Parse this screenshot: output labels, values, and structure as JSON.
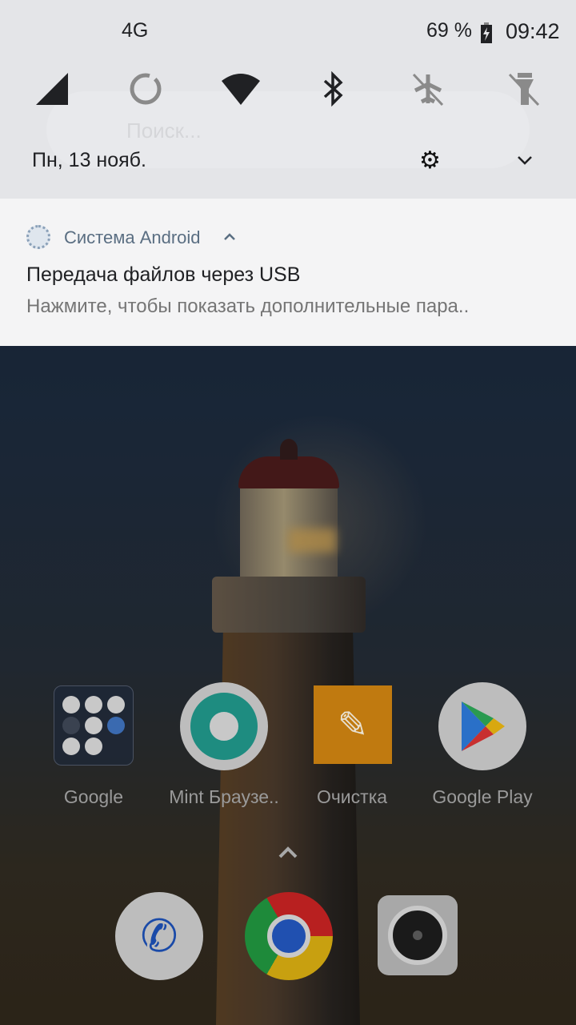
{
  "status_bar": {
    "network": "4G",
    "battery": "69 %",
    "time": "09:42"
  },
  "quick_settings": {
    "tiles": [
      {
        "icon": "signal-icon",
        "active": true
      },
      {
        "icon": "data-saver-icon",
        "active": false
      },
      {
        "icon": "wifi-icon",
        "active": true
      },
      {
        "icon": "bluetooth-icon",
        "active": true
      },
      {
        "icon": "airplane-mode-off-icon",
        "active": false
      },
      {
        "icon": "flashlight-off-icon",
        "active": false
      }
    ],
    "date": "Пн, 13 нояб."
  },
  "search_bar": {
    "placeholder": "Поиск..."
  },
  "notification": {
    "app": "Система Android",
    "title": "Передача файлов через USB",
    "text": "Нажмите, чтобы показать дополнительные пара.."
  },
  "home": {
    "apps": [
      {
        "label": "Google"
      },
      {
        "label": "Mint Браузе.."
      },
      {
        "label": "Очистка"
      },
      {
        "label": "Google Play"
      }
    ],
    "dock": [
      {
        "icon": "phone-icon"
      },
      {
        "icon": "chrome-icon"
      },
      {
        "icon": "camera-icon"
      }
    ]
  }
}
